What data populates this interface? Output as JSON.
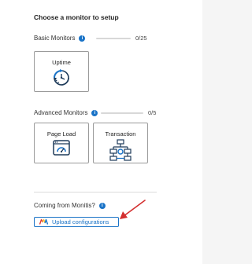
{
  "heading": "Choose a monitor to setup",
  "basic": {
    "label": "Basic Monitors",
    "count": "0/25",
    "progress": 0,
    "cards": [
      {
        "label": "Uptime",
        "icon": "uptime-clock-icon"
      }
    ]
  },
  "advanced": {
    "label": "Advanced Monitors",
    "count": "0/5",
    "progress": 0,
    "cards": [
      {
        "label": "Page Load",
        "icon": "page-load-icon"
      },
      {
        "label": "Transaction",
        "icon": "transaction-flow-icon"
      }
    ]
  },
  "migration": {
    "label": "Coming from Monitis?",
    "button_label": "Upload configurations",
    "button_icon": "monitis-logo-icon"
  },
  "info_glyph": "i",
  "colors": {
    "accent": "#1a73c7",
    "arrow": "#d32f2f"
  }
}
